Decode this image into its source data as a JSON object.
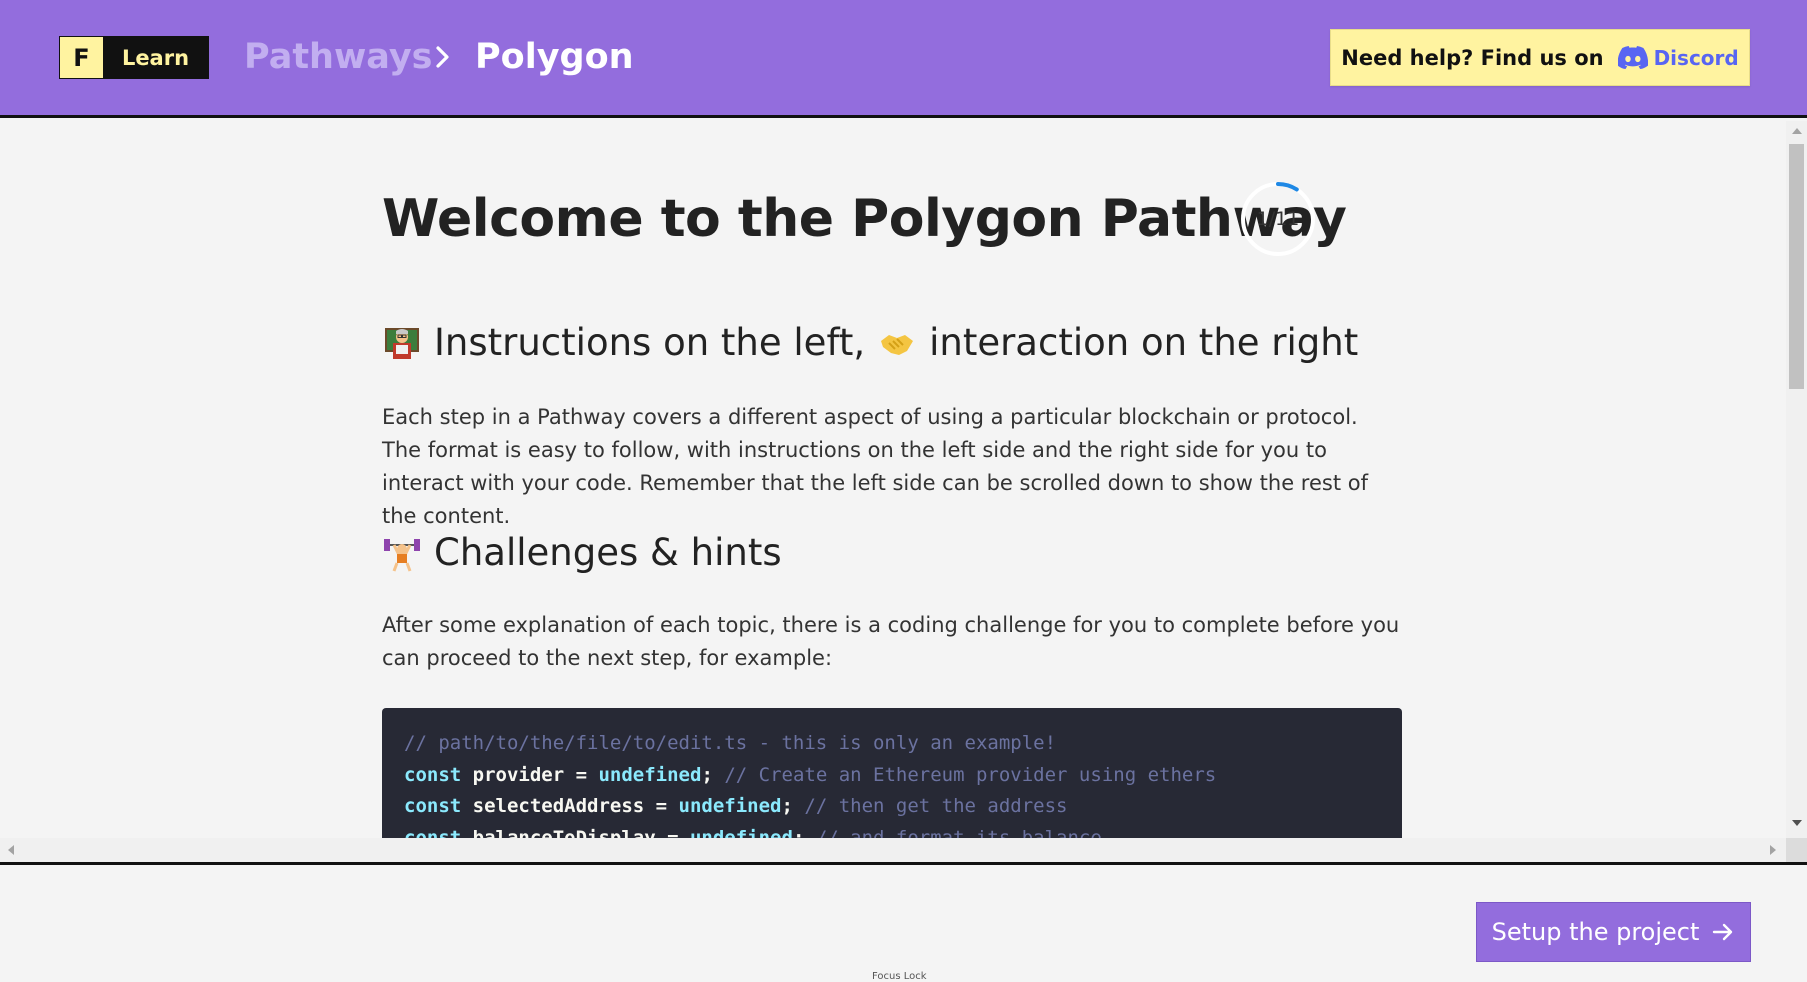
{
  "header": {
    "logo_letter": "F",
    "logo_text": "Learn",
    "breadcrumb": [
      "Pathways",
      "Polygon"
    ],
    "help_text": "Need help? Find us on",
    "discord_label": "Discord"
  },
  "main": {
    "title": "Welcome to the Polygon Pathway",
    "progress_label": "1/11",
    "progress_fraction": 0.09,
    "section1": {
      "heading": "Instructions on the left,",
      "heading_tail": "interaction on the right",
      "icon_left": "teacher-emoji-icon",
      "icon_right": "handshake-emoji-icon",
      "body": "Each step in a Pathway covers a different aspect of using a particular blockchain or protocol. The format is easy to follow, with instructions on the left side and the right side for you to interact with your code. Remember that the left side can be scrolled down to show the rest of the content."
    },
    "section2": {
      "heading": "Challenges & hints",
      "icon": "weightlifter-emoji-icon",
      "body": "After some explanation of each topic, there is a coding challenge for you to complete before you can proceed to the next step, for example:"
    },
    "code": {
      "line1_comment": "// path/to/the/file/to/edit.ts - this is only an example!",
      "line2_kw": "const",
      "line2_id": " provider = ",
      "line2_val": "undefined",
      "line2_semi": "; ",
      "line2_comment": "// Create an Ethereum provider using ethers",
      "line3_kw": "const",
      "line3_id": " selectedAddress = ",
      "line3_val": "undefined",
      "line3_semi": "; ",
      "line3_comment": "// then get the address",
      "line4_kw": "const",
      "line4_id": " balanceToDisplay = ",
      "line4_val": "undefined",
      "line4_semi": "; ",
      "line4_comment": "// and format its balance"
    }
  },
  "footer": {
    "next_label": "Setup the project",
    "focus_lock": "Focus Lock"
  },
  "colors": {
    "brand_purple": "#936ddd",
    "accent_yellow": "#fff3a0",
    "code_bg": "#272935",
    "progress_blue": "#1e88e5"
  }
}
